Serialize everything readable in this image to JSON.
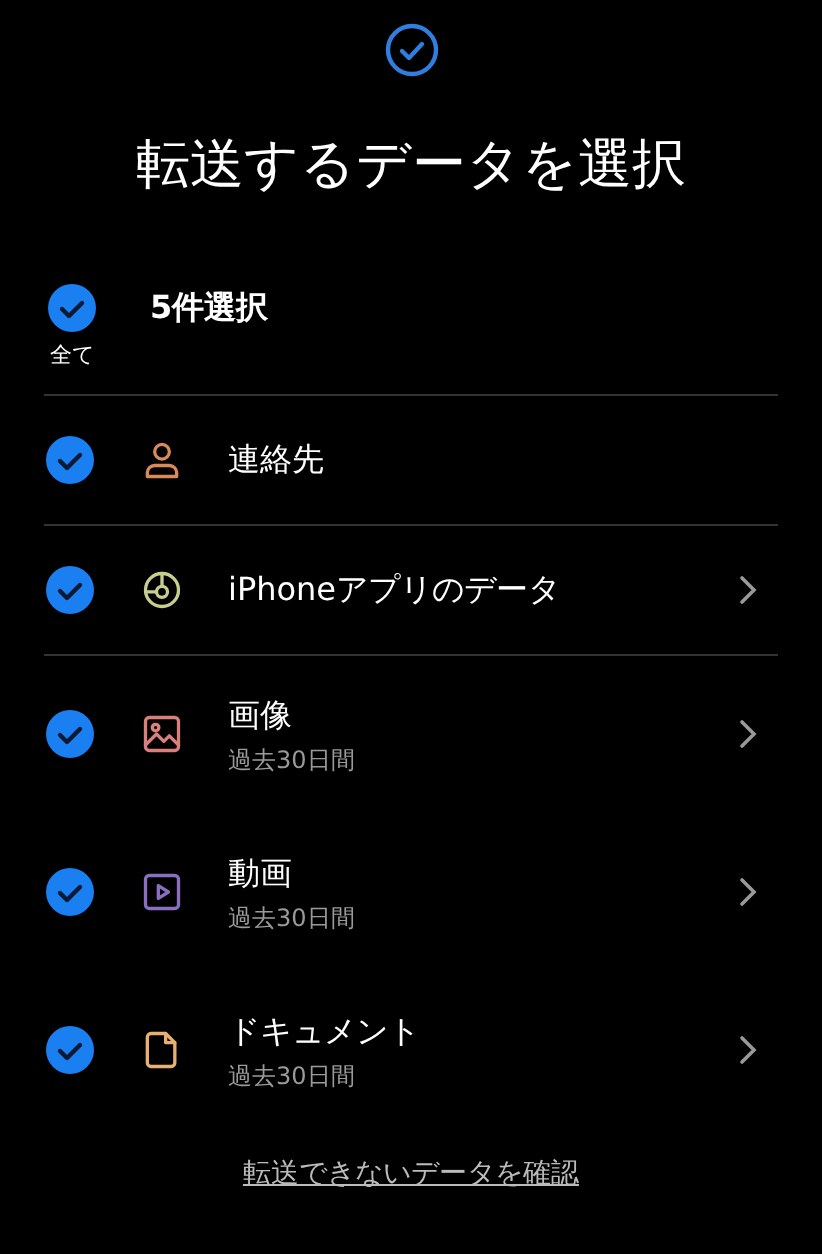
{
  "title": "転送するデータを選択",
  "select_all": {
    "label": "全て",
    "checked": true,
    "count": "5件選択"
  },
  "items": [
    {
      "kind": "contacts",
      "label": "連絡先",
      "checked": true,
      "chevron": false,
      "divider": true
    },
    {
      "kind": "app",
      "label": "iPhoneアプリのデータ",
      "checked": true,
      "chevron": true,
      "divider": true
    },
    {
      "kind": "image",
      "label": "画像",
      "subtitle": "過去30日間",
      "checked": true,
      "chevron": true,
      "divider": false
    },
    {
      "kind": "video",
      "label": "動画",
      "subtitle": "過去30日間",
      "checked": true,
      "chevron": true,
      "divider": false
    },
    {
      "kind": "document",
      "label": "ドキュメント",
      "subtitle": "過去30日間",
      "checked": true,
      "chevron": true,
      "divider": false
    }
  ],
  "link": "転送できないデータを確認"
}
